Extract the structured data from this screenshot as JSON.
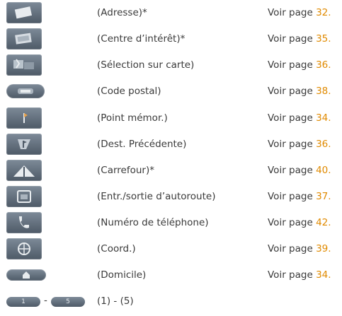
{
  "rows": [
    {
      "label": "(Adresse)*",
      "ref_prefix": "Voir page ",
      "page": "32.",
      "icon": "address-icon"
    },
    {
      "label": "(Centre d’intérêt)*",
      "ref_prefix": "Voir page ",
      "page": "35.",
      "icon": "poi-icon"
    },
    {
      "label": "(Sélection sur carte)",
      "ref_prefix": "Voir page ",
      "page": "36.",
      "icon": "map-select-icon"
    },
    {
      "label": "(Code postal)",
      "ref_prefix": "Voir page ",
      "page": "38.",
      "icon": "postal-code-icon"
    },
    {
      "label": "(Point mémor.)",
      "ref_prefix": "Voir page ",
      "page": "34.",
      "icon": "memory-point-icon"
    },
    {
      "label": "(Dest. Précédente)",
      "ref_prefix": "Voir page ",
      "page": "36.",
      "icon": "previous-destination-icon"
    },
    {
      "label": "(Carrefour)*",
      "ref_prefix": "Voir page ",
      "page": "40.",
      "icon": "intersection-icon"
    },
    {
      "label": "(Entr./sortie d’autoroute)",
      "ref_prefix": "Voir page ",
      "page": "37.",
      "icon": "freeway-exit-icon"
    },
    {
      "label": "(Numéro de téléphone)",
      "ref_prefix": "Voir page ",
      "page": "42.",
      "icon": "phone-icon"
    },
    {
      "label": "(Coord.)",
      "ref_prefix": "Voir page ",
      "page": "39.",
      "icon": "coordinates-icon"
    },
    {
      "label": "(Domicile)",
      "ref_prefix": "Voir page ",
      "page": "34.",
      "icon": "home-icon"
    }
  ],
  "last_row": {
    "label": "(1) - (5)",
    "dash": "-",
    "icon_left_digit": "1",
    "icon_right_digit": "5",
    "icon": "preset-buttons-icon"
  },
  "colors": {
    "text": "#3a3a3a",
    "page_number": "#e08a00",
    "icon_bg": "#5a6673"
  }
}
